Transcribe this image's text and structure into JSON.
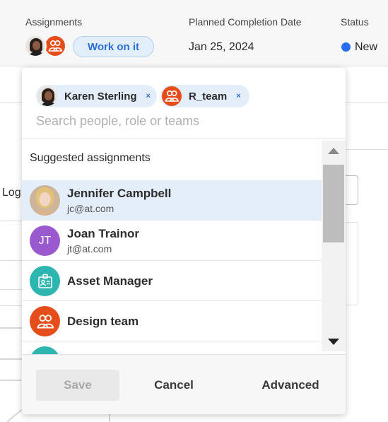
{
  "header": {
    "assignments_label": "Assignments",
    "work_on_it_label": "Work on it",
    "planned_completion_label": "Planned Completion Date",
    "planned_completion_value": "Jan 25, 2024",
    "status_label": "Status",
    "status_value": "New",
    "status_color": "#2a6cf0"
  },
  "background": {
    "partial_text": "Log"
  },
  "popover": {
    "chips": [
      {
        "label": "Karen Sterling",
        "type": "person",
        "remove_icon": "×"
      },
      {
        "label": "R_team",
        "type": "team",
        "remove_icon": "×"
      }
    ],
    "search_placeholder": "Search people, role or teams",
    "section_title": "Suggested assignments",
    "suggestions": [
      {
        "name": "Jennifer Campbell",
        "email": "jc@at.com",
        "avatar": "photo",
        "selected": true
      },
      {
        "name": "Joan Trainor",
        "email": "jt@at.com",
        "avatar": "initials",
        "initials": "JT",
        "avatar_color": "#9b59d0"
      },
      {
        "name": "Asset Manager",
        "avatar": "role-icon",
        "avatar_color": "#2db5b0"
      },
      {
        "name": "Design team",
        "avatar": "team-icon",
        "avatar_color": "#e54e1b"
      }
    ],
    "footer": {
      "save_label": "Save",
      "cancel_label": "Cancel",
      "advanced_label": "Advanced"
    }
  },
  "colors": {
    "accent": "#2b6fd6",
    "chip_bg": "#e4eefa",
    "team_orange": "#e54e1b",
    "role_teal": "#2db5b0",
    "initials_purple": "#9b59d0"
  }
}
